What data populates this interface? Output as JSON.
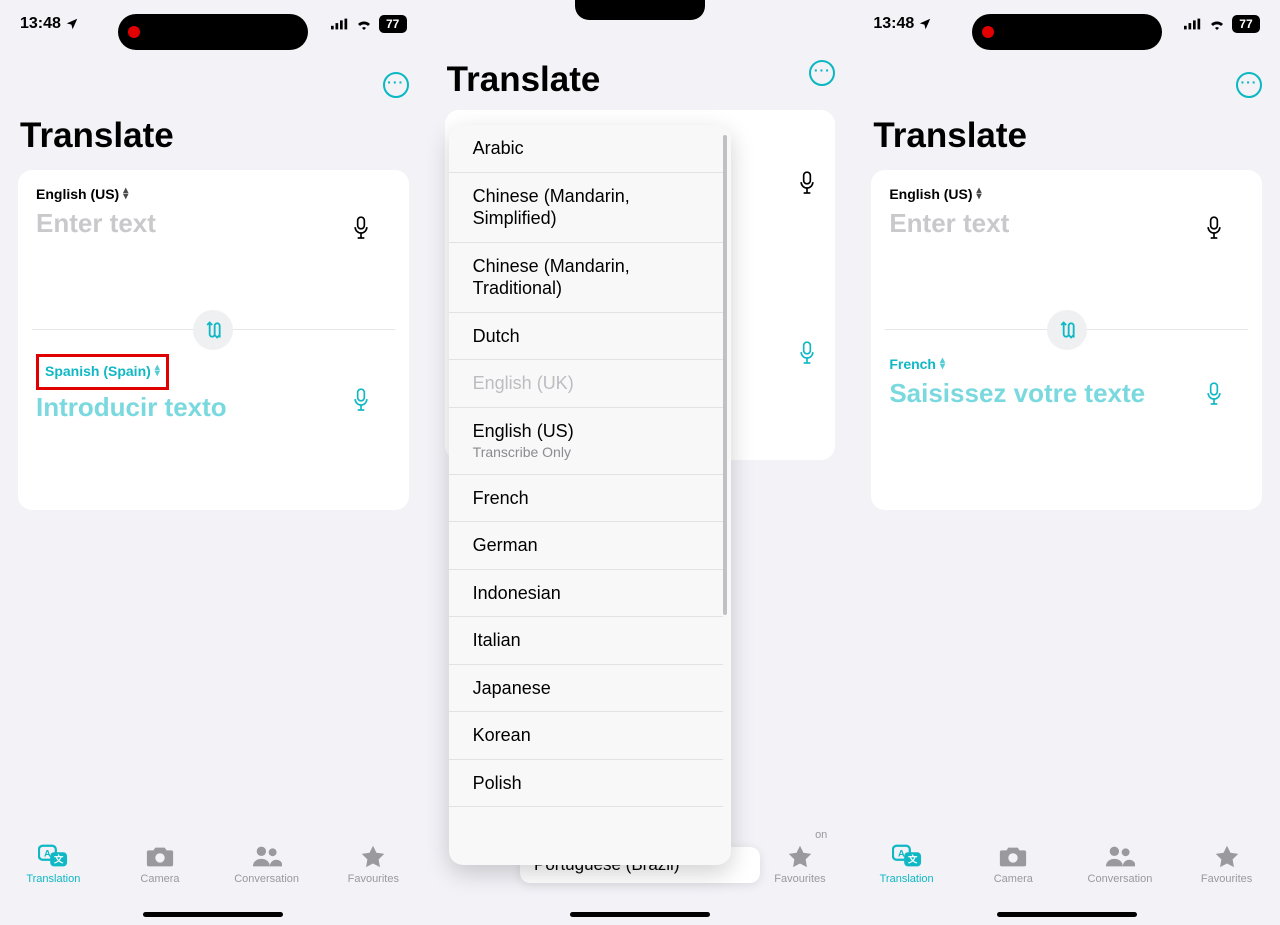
{
  "status": {
    "time": "13:48",
    "battery": "77"
  },
  "header": {
    "title": "Translate"
  },
  "moreLabel": "···",
  "screen1": {
    "sourceLang": "English (US)",
    "sourcePlaceholder": "Enter text",
    "targetLang": "Spanish (Spain)",
    "targetPlaceholder": "Introducir texto"
  },
  "screen3": {
    "sourceLang": "English (US)",
    "sourcePlaceholder": "Enter text",
    "targetLang": "French",
    "targetPlaceholder": "Saisissez votre texte"
  },
  "languages": [
    {
      "label": "Arabic"
    },
    {
      "label": "Chinese (Mandarin, Simplified)"
    },
    {
      "label": "Chinese (Mandarin, Traditional)"
    },
    {
      "label": "Dutch"
    },
    {
      "label": "English (UK)",
      "disabled": true
    },
    {
      "label": "English (US)",
      "sub": "Transcribe Only"
    },
    {
      "label": "French"
    },
    {
      "label": "German"
    },
    {
      "label": "Indonesian"
    },
    {
      "label": "Italian"
    },
    {
      "label": "Japanese"
    },
    {
      "label": "Korean"
    },
    {
      "label": "Polish"
    }
  ],
  "cutoffLang": "Portuguese (Brazil)",
  "tabs": {
    "translation": "Translation",
    "camera": "Camera",
    "conversation": "Conversation",
    "favourites": "Favourites"
  }
}
